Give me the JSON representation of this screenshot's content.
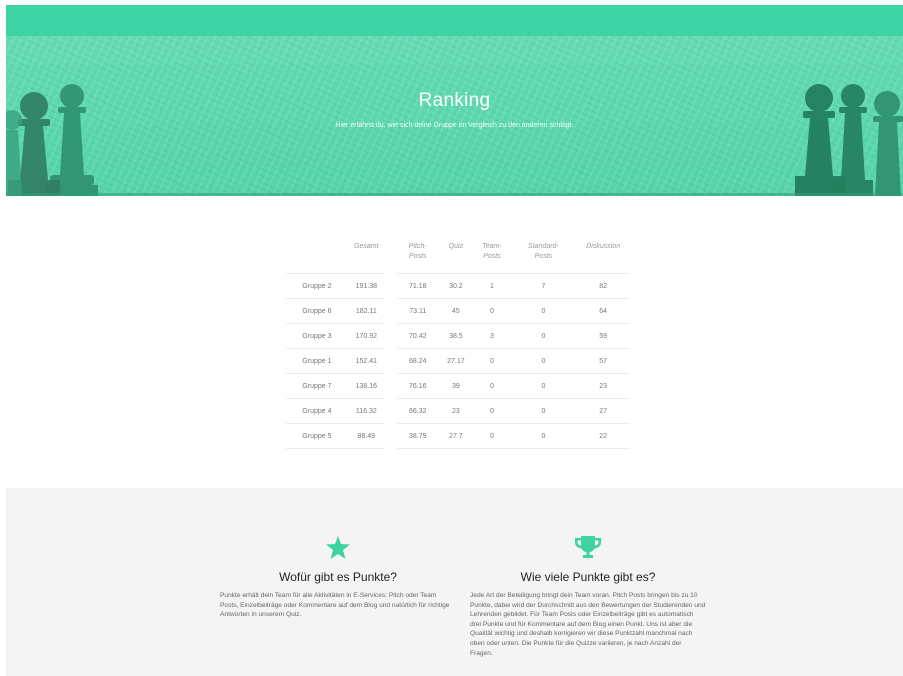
{
  "hero": {
    "title": "Ranking",
    "subtitle": "Hier erfährst du, wie sich deine Gruppe im Vergleich zu den anderen schlägt."
  },
  "ranking": {
    "headers": {
      "gesamt": "Gesamt",
      "pitch": [
        "Pitch-",
        "Posts"
      ],
      "quiz": "Quiz",
      "team": [
        "Team-",
        "Posts"
      ],
      "standard": [
        "Standard-",
        "Posts"
      ],
      "diskussion": "Diskussion"
    },
    "rows": [
      {
        "group": "Gruppe 2",
        "gesamt": "191.38",
        "pitch": "71.18",
        "quiz": "30.2",
        "team": "1",
        "standard": "7",
        "diskussion": "82"
      },
      {
        "group": "Gruppe 6",
        "gesamt": "182.11",
        "pitch": "73.11",
        "quiz": "45",
        "team": "0",
        "standard": "0",
        "diskussion": "64"
      },
      {
        "group": "Gruppe 3",
        "gesamt": "170.92",
        "pitch": "70.42",
        "quiz": "38.5",
        "team": "3",
        "standard": "0",
        "diskussion": "59"
      },
      {
        "group": "Gruppe 1",
        "gesamt": "152.41",
        "pitch": "68.24",
        "quiz": "27.17",
        "team": "0",
        "standard": "0",
        "diskussion": "57"
      },
      {
        "group": "Gruppe 7",
        "gesamt": "138.16",
        "pitch": "76.16",
        "quiz": "39",
        "team": "0",
        "standard": "0",
        "diskussion": "23"
      },
      {
        "group": "Gruppe 4",
        "gesamt": "116.32",
        "pitch": "66.32",
        "quiz": "23",
        "team": "0",
        "standard": "0",
        "diskussion": "27"
      },
      {
        "group": "Gruppe 5",
        "gesamt": "88.49",
        "pitch": "38.79",
        "quiz": "27.7",
        "team": "0",
        "standard": "0",
        "diskussion": "22"
      }
    ]
  },
  "info": {
    "left": {
      "icon": "star-icon",
      "title": "Wofür gibt es Punkte?",
      "text": "Punkte erhält dein Team für alle Aktivitäten in E-Services: Pitch oder Team Posts, Einzelbeiträge oder Kommentare auf dem Blog und natürlich für richtige Antworten in unserem Quiz."
    },
    "right": {
      "icon": "trophy-icon",
      "title": "Wie viele Punkte gibt es?",
      "text": "Jede Art der Beteiligung bringt dein Team voran. Pitch Posts bringen bis zu 10 Punkte, dabei wird der Durchschnitt aus den Bewertungen der Studierenden und Lehrenden gebildet. Für Team Posts oder Einzelbeiträge gibt es automatisch drei Punkte und für Kommentare auf dem Blog einen Punkt. Uns ist aber die Qualität wichtig und deshalb korrigieren wir diese Punktzahl manchmal nach oben oder unten. Die Punkte für die Quizze variieren, je nach Anzahl der Fragen."
    }
  },
  "colors": {
    "accent": "#3dd3a3",
    "hero": "#5fd9b1",
    "info_bg": "#f4f4f4"
  }
}
